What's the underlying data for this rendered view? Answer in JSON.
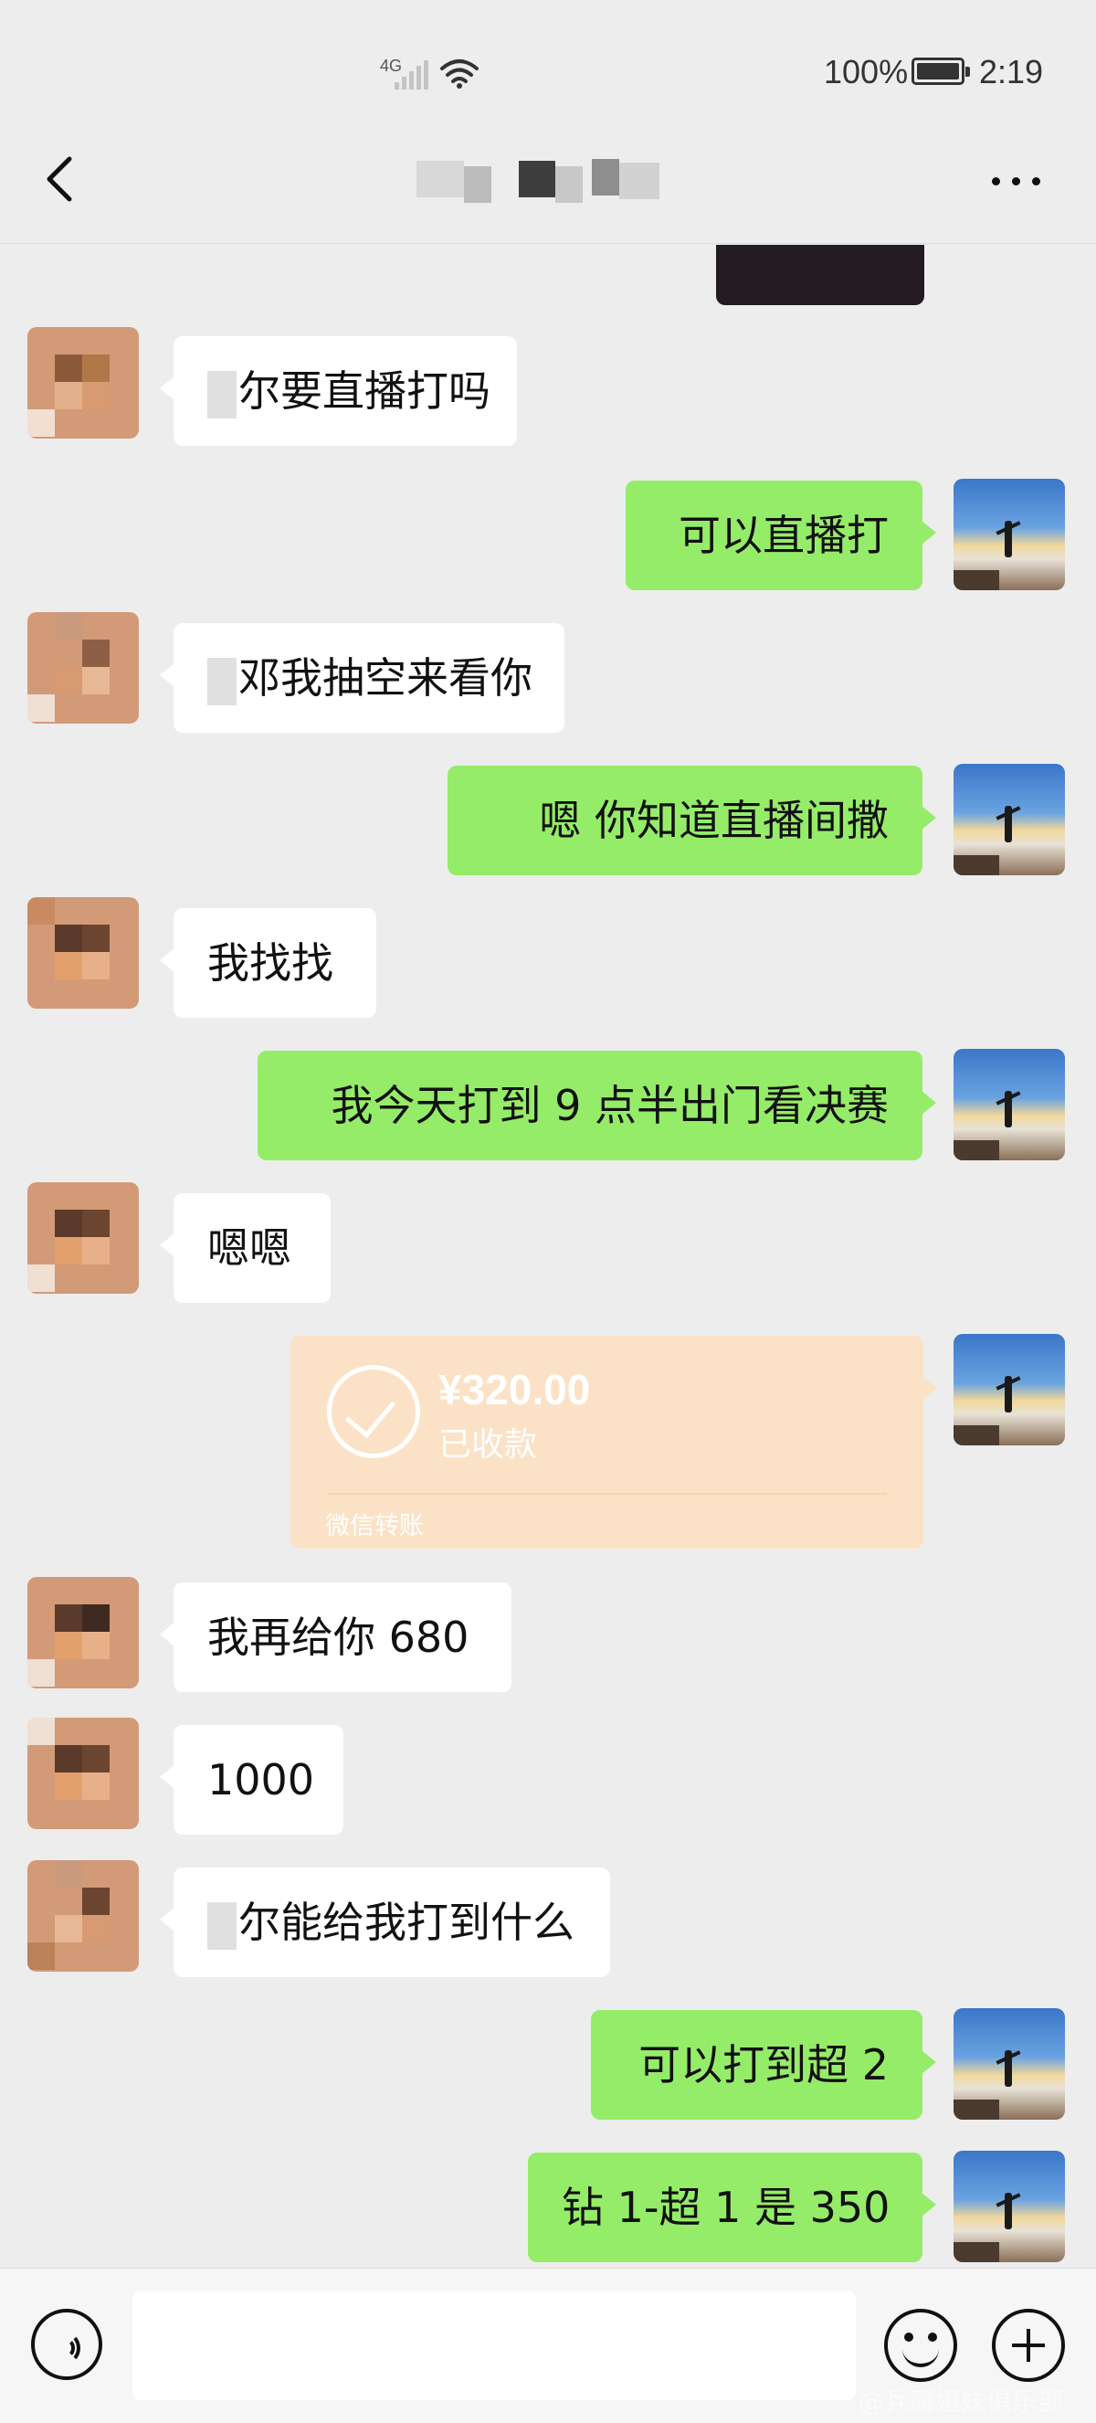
{
  "status_bar": {
    "network_label": "4G",
    "battery_percent": "100%",
    "time": "2:19"
  },
  "header": {
    "back_icon": "chevron-left-icon",
    "contact_name_obscured": true,
    "more_icon": "more-dots-icon"
  },
  "messages": [
    {
      "side": "left",
      "text": "你要直播打吗",
      "display": "尔要直播打吗",
      "obscured_first_char": true
    },
    {
      "side": "right",
      "text": "可以直播打"
    },
    {
      "side": "left",
      "text": "那我抽空来看你",
      "display": "邓我抽空来看你",
      "obscured_first_char": true
    },
    {
      "side": "right",
      "text": "嗯 你知道直播间撒"
    },
    {
      "side": "left",
      "text": "我找找"
    },
    {
      "side": "right",
      "text": "我今天打到 9 点半出门看决赛"
    },
    {
      "side": "left",
      "text": "嗯嗯"
    },
    {
      "side": "right",
      "type": "transfer",
      "amount": "¥320.00",
      "status": "已收款",
      "source": "微信转账"
    },
    {
      "side": "left",
      "text": "我再给你 680"
    },
    {
      "side": "left",
      "text": "1000"
    },
    {
      "side": "left",
      "text": "你能给我打到什么",
      "display": "尔能给我打到什么",
      "obscured_first_char": true
    },
    {
      "side": "right",
      "text": "可以打到超 2"
    },
    {
      "side": "right",
      "text": "钻 1-超 1 是 350"
    }
  ],
  "bubbles": {
    "m1": "尔要直播打吗",
    "m2": "可以直播打",
    "m3": "邓我抽空来看你",
    "m4": "嗯 你知道直播间撒",
    "m5": "我找找",
    "m6": "我今天打到 9 点半出门看决赛",
    "m7": "嗯嗯",
    "m9": "我再给你 680",
    "m10": "1000",
    "m11": "尔能给我打到什么",
    "m12": "可以打到超 2",
    "m13": "钻 1-超 1 是 350"
  },
  "transfer": {
    "amount": "¥320.00",
    "status": "已收款",
    "source": "微信转账"
  },
  "input_bar": {
    "voice_icon": "voice-icon",
    "input_value": "",
    "emoji_icon": "emoji-icon",
    "plus_icon": "plus-icon"
  },
  "watermark": "@兵魔姐妹俱乐部",
  "colors": {
    "background": "#ededed",
    "own_bubble": "#95ec69",
    "other_bubble": "#ffffff",
    "transfer_card": "#fbe2c6"
  }
}
